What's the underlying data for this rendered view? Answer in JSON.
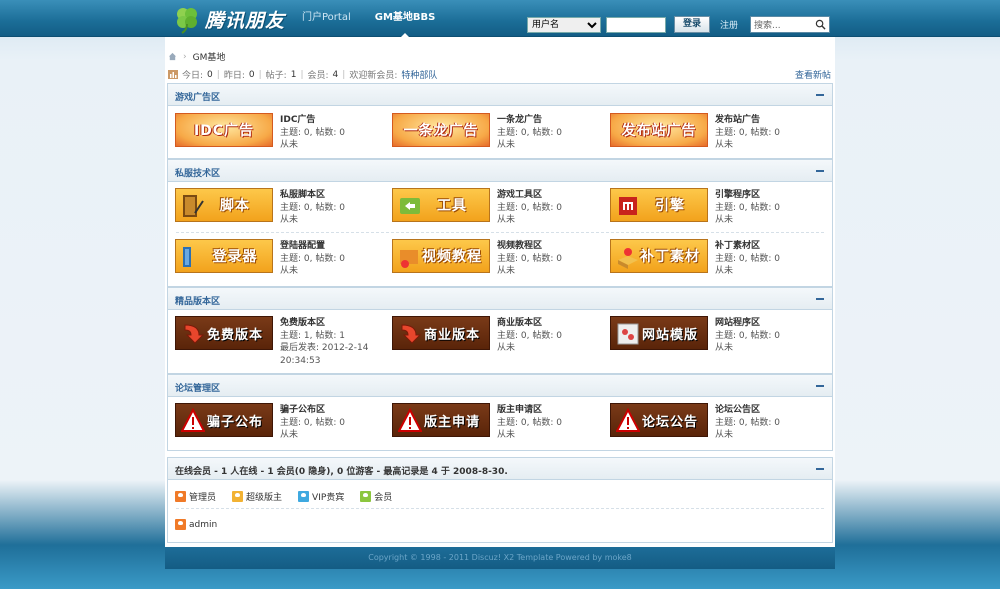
{
  "header": {
    "logo_text": "腾讯朋友",
    "nav": [
      "门户Portal",
      "GM基地BBS"
    ],
    "login": {
      "select_value": "用户名",
      "password_value": "",
      "login_button": "登录",
      "register_link": "注册"
    },
    "search_placeholder": "搜索..."
  },
  "breadcrumb": {
    "current": "GM基地"
  },
  "stats": {
    "today_label": "今日:",
    "today": "0",
    "yesterday_label": "昨日:",
    "yesterday": "0",
    "posts_label": "帖子:",
    "posts": "1",
    "members_label": "会员:",
    "members": "4",
    "welcome_label": "欢迎新会员:",
    "new_member": "特种部队",
    "view_new": "查看新帖"
  },
  "sections": [
    {
      "title": "游戏广告区",
      "forums": [
        {
          "banner": "IDC广告",
          "name": "IDC广告",
          "meta": "主题: 0, 帖数: 0",
          "last": "从未"
        },
        {
          "banner": "一条龙广告",
          "name": "一条龙广告",
          "meta": "主题: 0, 帖数: 0",
          "last": "从未"
        },
        {
          "banner": "发布站广告",
          "name": "发布站广告",
          "meta": "主题: 0, 帖数: 0",
          "last": "从未"
        }
      ]
    },
    {
      "title": "私服技术区",
      "forums": [
        {
          "banner": "脚本",
          "name": "私服脚本区",
          "meta": "主题: 0, 帖数: 0",
          "last": "从未"
        },
        {
          "banner": "工具",
          "name": "游戏工具区",
          "meta": "主题: 0, 帖数: 0",
          "last": "从未"
        },
        {
          "banner": "引擎",
          "name": "引擎程序区",
          "meta": "主题: 0, 帖数: 0",
          "last": "从未"
        },
        {
          "banner": "登录器",
          "name": "登陆器配置",
          "meta": "主题: 0, 帖数: 0",
          "last": "从未"
        },
        {
          "banner": "视频教程",
          "name": "视频教程区",
          "meta": "主题: 0, 帖数: 0",
          "last": "从未"
        },
        {
          "banner": "补丁素材",
          "name": "补丁素材区",
          "meta": "主题: 0, 帖数: 0",
          "last": "从未"
        }
      ]
    },
    {
      "title": "精品版本区",
      "forums": [
        {
          "banner": "免费版本",
          "name": "免费版本区",
          "meta": "主题: 1, 帖数: 1",
          "last": "最后发表: 2012-2-14",
          "last2": "20:34:53"
        },
        {
          "banner": "商业版本",
          "name": "商业版本区",
          "meta": "主题: 0, 帖数: 0",
          "last": "从未"
        },
        {
          "banner": "网站模版",
          "name": "网站程序区",
          "meta": "主题: 0, 帖数: 0",
          "last": "从未"
        }
      ]
    },
    {
      "title": "论坛管理区",
      "forums": [
        {
          "banner": "骗子公布",
          "name": "骗子公布区",
          "meta": "主题: 0, 帖数: 0",
          "last": "从未"
        },
        {
          "banner": "版主申请",
          "name": "版主申请区",
          "meta": "主题: 0, 帖数: 0",
          "last": "从未"
        },
        {
          "banner": "论坛公告",
          "name": "论坛公告区",
          "meta": "主题: 0, 帖数: 0",
          "last": "从未"
        }
      ]
    }
  ],
  "online": {
    "title": "在线会员 - 1 人在线 - 1 会员(0 隐身), 0 位游客 - 最高记录是 4 于 2008-8-30.",
    "legend": [
      "管理员",
      "超级版主",
      "VIP贵宾",
      "会员"
    ],
    "users": [
      "admin"
    ]
  },
  "footer": "Copyright © 1998 - 2011 Discuz! X2 Template Powered by moke8"
}
